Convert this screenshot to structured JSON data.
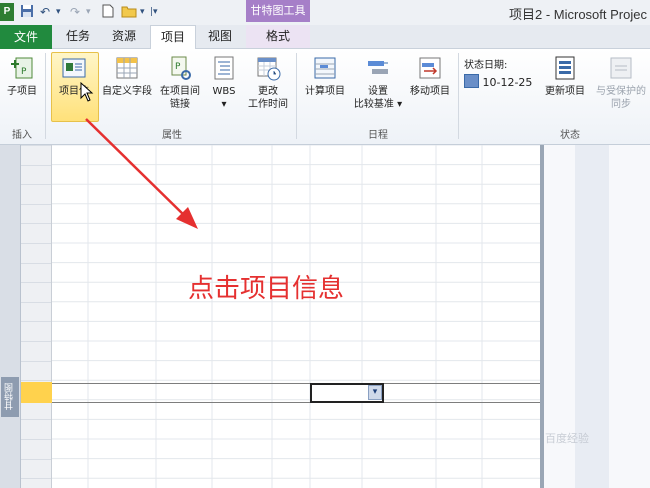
{
  "app": {
    "window_title": "项目2 - Microsoft Projec",
    "contextual_tool": "甘特图工具",
    "accent": "#218a3e",
    "contextual_color": "#a67fc8"
  },
  "tabs": {
    "file": "文件",
    "task": "任务",
    "resource": "资源",
    "project": "项目",
    "view": "视图",
    "format": "格式"
  },
  "ribbon": {
    "insert": {
      "subproject": "子项目",
      "group": "插入"
    },
    "properties": {
      "project_info": "项目信",
      "custom_fields": "自定义字段",
      "links_line1": "在项目间",
      "links_line2": "链接",
      "wbs": "WBS",
      "change_line1": "更改",
      "change_line2": "工作时间",
      "group": "属性"
    },
    "schedule": {
      "calculate": "计算项目",
      "baseline_line1": "设置",
      "baseline_line2": "比较基准",
      "move": "移动项目",
      "group": "日程"
    },
    "status": {
      "status_date_label": "状态日期:",
      "status_date": "10-12-25",
      "update": "更新项目",
      "sync_line1": "与受保护的",
      "sync_line2": "同步",
      "group": "状态"
    }
  },
  "side": {
    "vertical_label": "甘特图"
  },
  "annotation": {
    "text": "点击项目信息",
    "color": "#e53030"
  },
  "watermark": "百度经验"
}
